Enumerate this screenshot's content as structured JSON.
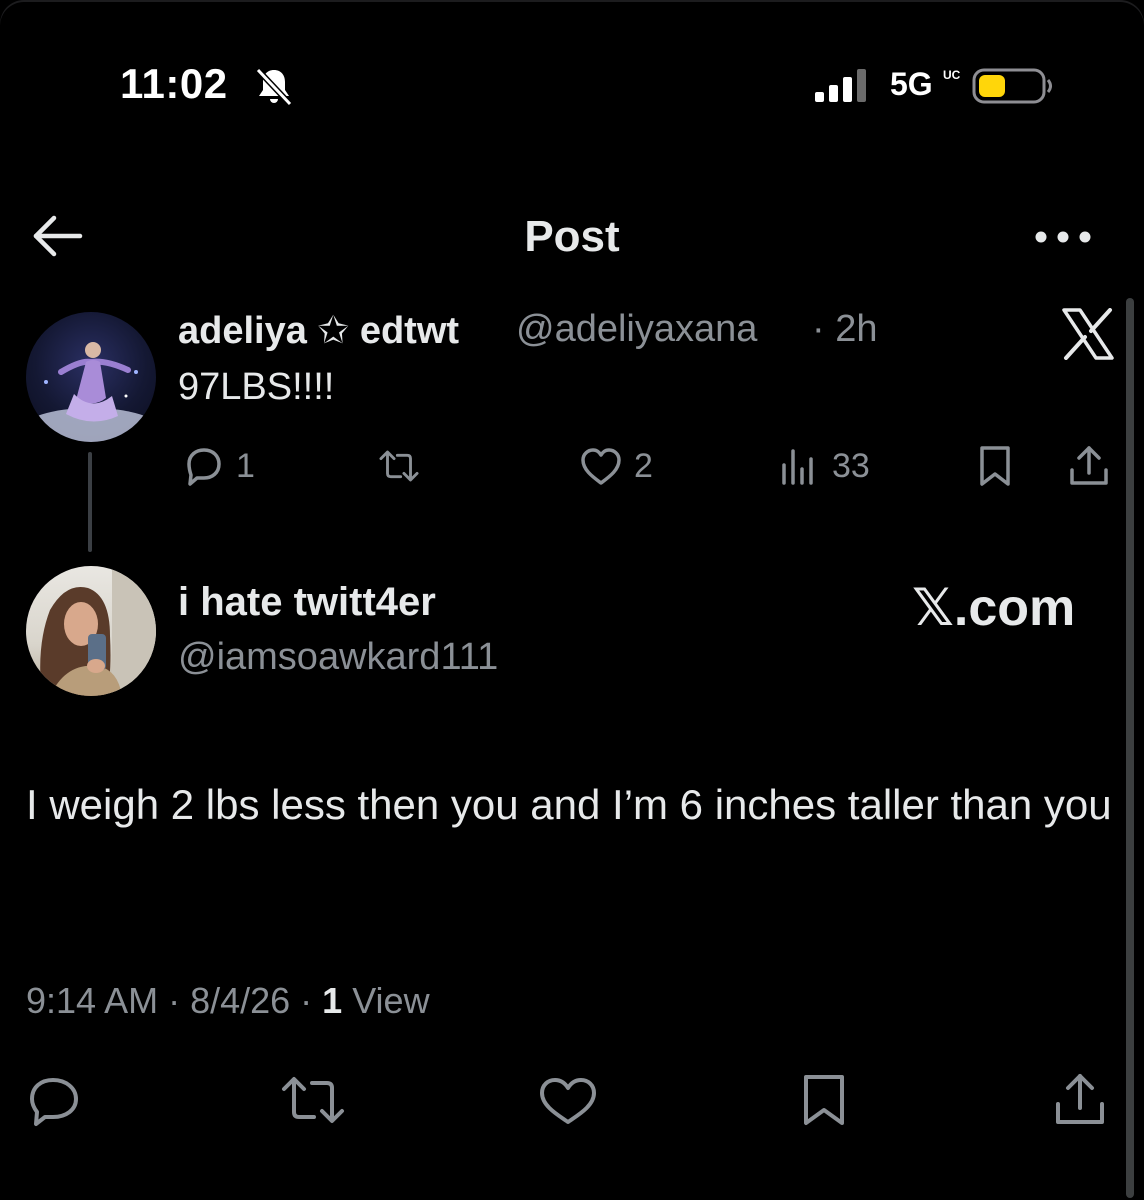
{
  "status_bar": {
    "time": "11:02",
    "network": "5G",
    "network_sub": "UC",
    "battery_color": "#ffd60a"
  },
  "header": {
    "title": "Post",
    "back_icon": "arrow-left-icon",
    "more_icon": "more-dots-icon"
  },
  "quoted_post": {
    "display_name": "adeliya ✩ edtwt",
    "handle": "@adeliyaxana",
    "time": "· 2h",
    "text": "97LBS!!!!",
    "actions": {
      "replies": "1",
      "likes": "2",
      "views": "33"
    }
  },
  "reply_post": {
    "display_name": "i hate twitt4er",
    "handle": "@iamsoawkard111",
    "watermark": "𝕏.com",
    "text": "I weigh 2 lbs less then you and I’m 6 inches taller than you",
    "timestamp": "9:14 AM · 8/4/26 · ",
    "view_count": "1",
    "view_label": " View"
  },
  "colors": {
    "background": "#000000",
    "primary_text": "#e7e9ea",
    "secondary_text": "#8b9096"
  }
}
